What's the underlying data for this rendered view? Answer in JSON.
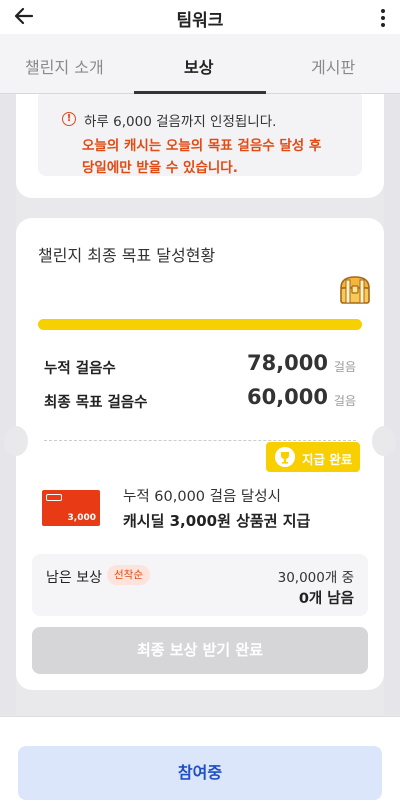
{
  "header": {
    "title": "팀워크"
  },
  "tabs": [
    {
      "label": "챌린지 소개"
    },
    {
      "label": "보상"
    },
    {
      "label": "게시판"
    }
  ],
  "notice": {
    "line1": "하루 6,000 걸음까지 인정됩니다.",
    "line2": "오늘의 캐시는 오늘의 목표 걸음수 달성 후",
    "line3": "당일에만 받을 수 있습니다."
  },
  "status": {
    "title": "챌린지 최종 목표 달성현황",
    "progress_fraction": 1.0,
    "cumulative_label": "누적 걸음수",
    "cumulative_value": "78,000",
    "goal_label": "최종 목표 걸음수",
    "goal_value": "60,000",
    "unit": "걸음"
  },
  "badge": {
    "label": "지급 완료"
  },
  "reward": {
    "voucher_amount": "3,000",
    "condition": "누적 60,000 걸음 달성시",
    "description": "캐시딜 3,000원 상품권 지급"
  },
  "remaining": {
    "label": "남은 보상",
    "tag": "선착순",
    "total": "30,000개 중",
    "left": "0개 남음"
  },
  "claim_button": {
    "label": "최종 보상 받기 완료"
  },
  "join_button": {
    "label": "참여중"
  },
  "colors": {
    "accent_yellow": "#f8cf00",
    "alert_red": "#e24a12",
    "voucher_red": "#e83a14",
    "join_blue": "#1f4fc4"
  }
}
